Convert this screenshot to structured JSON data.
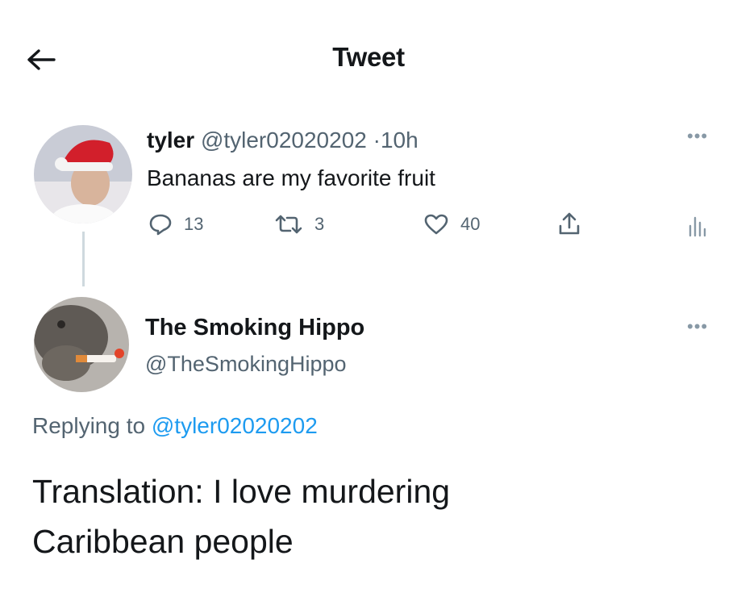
{
  "header": {
    "title": "Tweet",
    "back_icon": "arrow-left-icon"
  },
  "parent_tweet": {
    "author_name": "tyler",
    "handle": "@tyler02020202",
    "separator": "·",
    "time": "10h",
    "text": "Bananas are my favorite fruit",
    "actions": {
      "replies": "13",
      "retweets": "3",
      "likes": "40"
    }
  },
  "reply_tweet": {
    "author_name": "The Smoking Hippo",
    "handle": "@TheSmokingHippo",
    "replying_prefix": "Replying to",
    "replying_handle": "@tyler02020202",
    "text_line1": "Translation: I love murdering",
    "text_line2": "Caribbean people"
  },
  "colors": {
    "link": "#1d9bf0",
    "muted": "#536471",
    "text": "#14171a"
  }
}
